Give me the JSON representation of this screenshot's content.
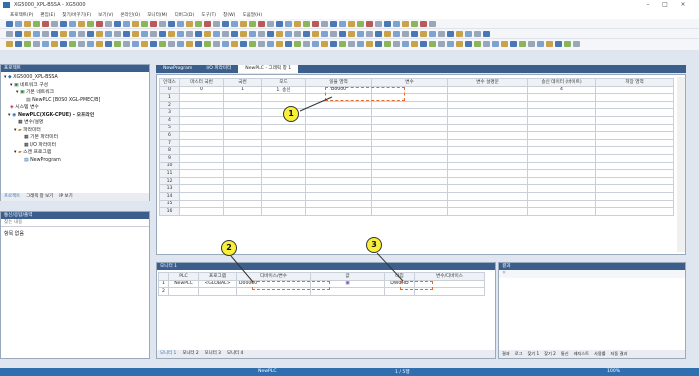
{
  "window": {
    "title": "XG5000_XPL-BSSA - XG5000",
    "min": "–",
    "max": "□",
    "close": "×"
  },
  "menu": [
    "프로젝트(P)",
    "편집(E)",
    "찾기/바꾸기(F)",
    "보기(V)",
    "온라인(O)",
    "모니터(M)",
    "디버그(D)",
    "도구(T)",
    "창(W)",
    "도움말(H)"
  ],
  "project": {
    "header": "프로젝트",
    "tree": [
      "XG5000_XPL-BSSA",
      "네트워크 구성",
      "기본 네트워크",
      "NewPLC [B0S0 XGL-PMEC/B]",
      "시스템 변수",
      "NewPLC(XGK-CPUE) - 오프라인",
      "변수/설명",
      "파라미터",
      "기본 파라미터",
      "I/O 파라미터",
      "스캔 프로그램",
      "NewProgram"
    ],
    "tabs": [
      "프로젝트",
      "그래픽 창 보기",
      "IP 보기"
    ]
  },
  "messages": {
    "header": "통신/응답/출력",
    "search": "찾는 내용",
    "empty": "항목 없음"
  },
  "editor_tabs": [
    "NewProgram",
    "I/O 파라미터",
    "NewPLC - 그래픽 창 1"
  ],
  "graphic_table": {
    "headers": [
      "인덱스",
      "마스터 국번",
      "국번",
      "모드",
      "읽을 영역",
      "변수",
      "변수 설명문",
      "송신 데이터 (바이트)",
      "저장 영역"
    ],
    "row0": [
      "0",
      "0",
      "1",
      "1. 송신",
      "D0000",
      "",
      "",
      "4",
      ""
    ],
    "rows": [
      "1",
      "2",
      "3",
      "4",
      "5",
      "6",
      "7",
      "8",
      "9",
      "10",
      "11",
      "12",
      "13",
      "14",
      "15",
      "16"
    ]
  },
  "monitor": {
    "header": "모니터 1",
    "headers": [
      "",
      "PLC",
      "프로그램",
      "디바이스/변수",
      "값",
      "타입",
      "변수/디바이스"
    ],
    "row1": [
      "1",
      "NewPLC",
      "<GLOBAL>",
      "D00000",
      "",
      "DWORD",
      ""
    ],
    "row2": [
      "2"
    ],
    "tabs": [
      "모니터 1",
      "모니터 2",
      "모니터 3",
      "모니터 4"
    ]
  },
  "output": {
    "header": "결과",
    "tabs": [
      "결과",
      "로그",
      "찾기 1",
      "찾기 2",
      "통신",
      "레지스트",
      "사용률",
      "자동 결과"
    ]
  },
  "status": {
    "plc": "NewPLC",
    "pos": "1 / 5행",
    "zoom": "100%"
  },
  "callouts": [
    "1",
    "2",
    "3"
  ],
  "colors": {
    "accent": "#2f6fb0",
    "callout": "#f7ef3a",
    "dash": "#e86a2a"
  }
}
